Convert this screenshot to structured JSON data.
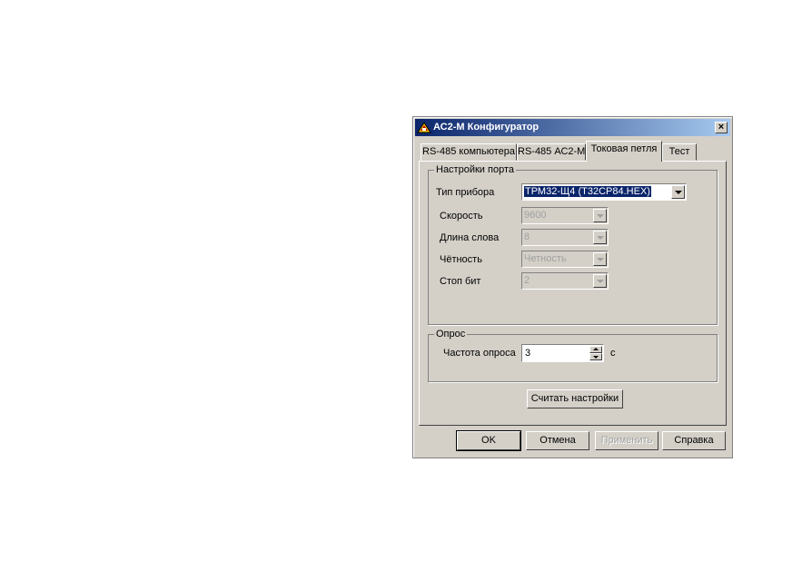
{
  "window": {
    "title": "АС2-М Конфигуратор",
    "close_label": "×",
    "titlebar_color": "#0a246a"
  },
  "tabs": [
    {
      "label": "RS-485 компьютера",
      "active": false
    },
    {
      "label": "RS-485 АС2-М",
      "active": false
    },
    {
      "label": "Токовая петля",
      "active": true
    },
    {
      "label": "Тест",
      "active": false
    }
  ],
  "port_settings": {
    "group_title": "Настройки порта",
    "device_type_label": "Тип прибора",
    "device_type_value": "ТРМ32-Щ4 (T32CP84.HEX)",
    "speed_label": "Скорость",
    "speed_value": "9600",
    "word_length_label": "Длина слова",
    "word_length_value": "8",
    "parity_label": "Чётность",
    "parity_value": "Четность",
    "stop_bits_label": "Стоп бит",
    "stop_bits_value": "2"
  },
  "polling": {
    "group_title": "Опрос",
    "frequency_label": "Частота опроса",
    "frequency_value": "3",
    "unit": "с"
  },
  "buttons": {
    "read_settings": "Считать настройки",
    "ok": "OK",
    "cancel": "Отмена",
    "apply": "Применить",
    "help": "Справка"
  }
}
